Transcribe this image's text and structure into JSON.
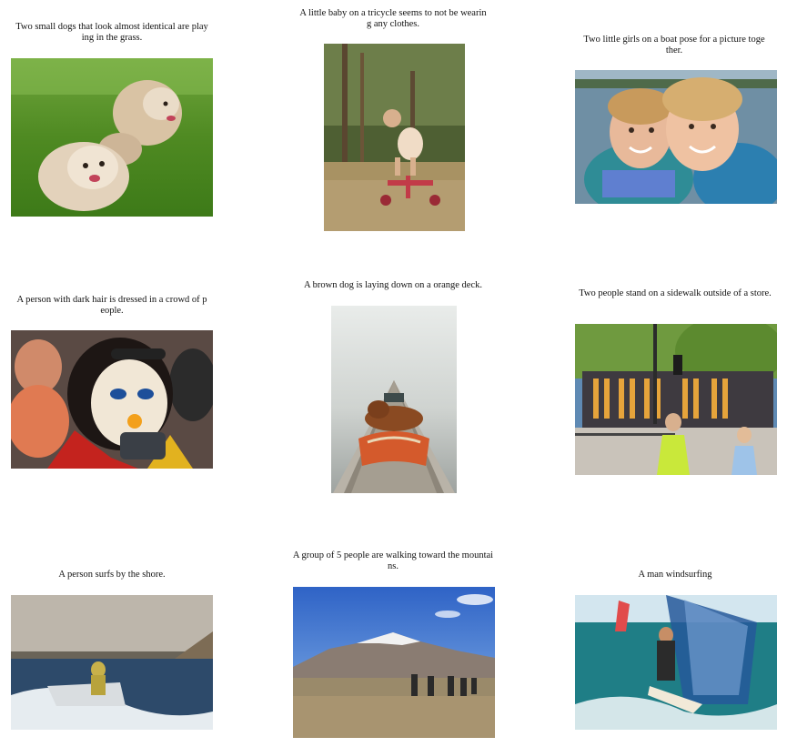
{
  "panels": [
    {
      "caption": "Two small dogs that look almost identical are play\ning in the grass.",
      "image": "two-dogs-grass"
    },
    {
      "caption": "A little baby on a tricycle seems to not be wearin\ng any clothes.",
      "image": "baby-tricycle"
    },
    {
      "caption": "Two little girls on a boat pose for a picture toge\nther.",
      "image": "two-girls-boat"
    },
    {
      "caption": "A person with dark hair is dressed in a crowd of p\neople.",
      "image": "painted-face-person"
    },
    {
      "caption": "A brown dog is laying down on a orange deck.",
      "image": "dog-in-canoe"
    },
    {
      "caption": "Two people stand on a sidewalk outside of a store.",
      "image": "two-people-sidewalk"
    },
    {
      "caption": "A person surfs by the shore.",
      "image": "person-jetski"
    },
    {
      "caption": "A group of 5 people are walking toward the mountai\nns.",
      "image": "hikers-mountain"
    },
    {
      "caption": "A man windsurfing",
      "image": "windsurfer"
    }
  ]
}
